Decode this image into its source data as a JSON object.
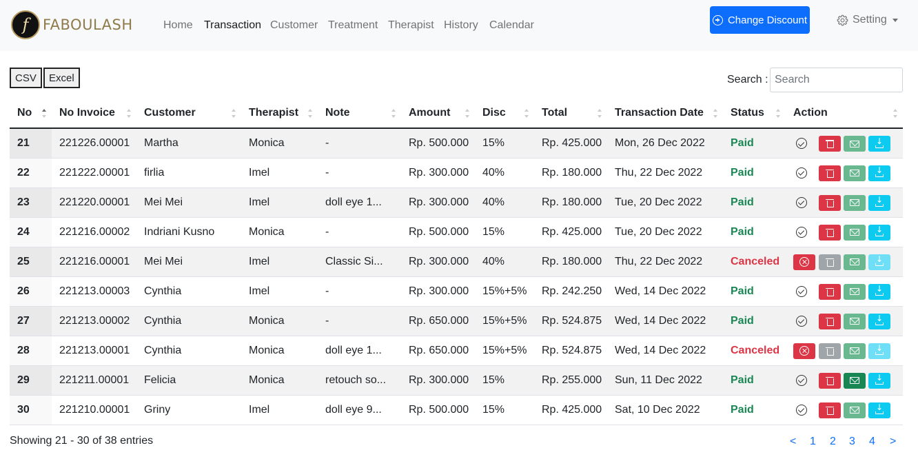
{
  "brand": {
    "name": "FABOULASH",
    "logo_glyph": "f"
  },
  "nav": [
    {
      "label": "Home",
      "active": false
    },
    {
      "label": "Transaction",
      "active": true
    },
    {
      "label": "Customer",
      "active": false
    },
    {
      "label": "Treatment",
      "active": false
    },
    {
      "label": "Therapist",
      "active": false
    },
    {
      "label": "History",
      "active": false
    },
    {
      "label": "Calendar",
      "active": false
    }
  ],
  "header": {
    "discount_button": "Change Discount",
    "setting_label": "Setting"
  },
  "toolbar": {
    "csv_label": "CSV",
    "excel_label": "Excel",
    "search_label": "Search :",
    "search_placeholder": "Search"
  },
  "table": {
    "columns": [
      "No",
      "No Invoice",
      "Customer",
      "Therapist",
      "Note",
      "Amount",
      "Disc",
      "Total",
      "Transaction Date",
      "Status",
      "Action"
    ],
    "rows": [
      {
        "no": "21",
        "invoice": "221226.00001",
        "customer": "Martha",
        "therapist": "Monica",
        "note": "-",
        "amount": "Rp. 500.000",
        "disc": "15%",
        "total": "Rp. 425.000",
        "date": "Mon, 26 Dec 2022",
        "status": "Paid"
      },
      {
        "no": "22",
        "invoice": "221222.00001",
        "customer": "firlia",
        "therapist": "Imel",
        "note": "-",
        "amount": "Rp. 300.000",
        "disc": "40%",
        "total": "Rp. 180.000",
        "date": "Thu, 22 Dec 2022",
        "status": "Paid"
      },
      {
        "no": "23",
        "invoice": "221220.00001",
        "customer": "Mei Mei",
        "therapist": "Imel",
        "note": "doll eye 1...",
        "amount": "Rp. 300.000",
        "disc": "40%",
        "total": "Rp. 180.000",
        "date": "Tue, 20 Dec 2022",
        "status": "Paid"
      },
      {
        "no": "24",
        "invoice": "221216.00002",
        "customer": "Indriani Kusno",
        "therapist": "Monica",
        "note": "-",
        "amount": "Rp. 500.000",
        "disc": "15%",
        "total": "Rp. 425.000",
        "date": "Tue, 20 Dec 2022",
        "status": "Paid"
      },
      {
        "no": "25",
        "invoice": "221216.00001",
        "customer": "Mei Mei",
        "therapist": "Imel",
        "note": "Classic Si...",
        "amount": "Rp. 300.000",
        "disc": "40%",
        "total": "Rp. 180.000",
        "date": "Thu, 22 Dec 2022",
        "status": "Canceled"
      },
      {
        "no": "26",
        "invoice": "221213.00003",
        "customer": "Cynthia",
        "therapist": "Imel",
        "note": "-",
        "amount": "Rp. 300.000",
        "disc": "15%+5%",
        "total": "Rp. 242.250",
        "date": "Wed, 14 Dec 2022",
        "status": "Paid"
      },
      {
        "no": "27",
        "invoice": "221213.00002",
        "customer": "Cynthia",
        "therapist": "Monica",
        "note": "-",
        "amount": "Rp. 650.000",
        "disc": "15%+5%",
        "total": "Rp. 524.875",
        "date": "Wed, 14 Dec 2022",
        "status": "Paid"
      },
      {
        "no": "28",
        "invoice": "221213.00001",
        "customer": "Cynthia",
        "therapist": "Monica",
        "note": "doll eye 1...",
        "amount": "Rp. 650.000",
        "disc": "15%+5%",
        "total": "Rp. 524.875",
        "date": "Wed, 14 Dec 2022",
        "status": "Canceled"
      },
      {
        "no": "29",
        "invoice": "221211.00001",
        "customer": "Felicia",
        "therapist": "Monica",
        "note": "retouch so...",
        "amount": "Rp. 300.000",
        "disc": "15%",
        "total": "Rp. 255.000",
        "date": "Sun, 11 Dec 2022",
        "status": "Paid",
        "mail_dark": true
      },
      {
        "no": "30",
        "invoice": "221210.00001",
        "customer": "Griny",
        "therapist": "Imel",
        "note": "doll eye 9...",
        "amount": "Rp. 500.000",
        "disc": "15%",
        "total": "Rp. 425.000",
        "date": "Sat, 10 Dec 2022",
        "status": "Paid"
      }
    ]
  },
  "footer": {
    "info": "Showing 21 - 30 of 38 entries",
    "pages": [
      "<",
      "1",
      "2",
      "3",
      "4",
      ">"
    ]
  },
  "colors": {
    "primary": "#0d6efd",
    "paid": "#198754",
    "canceled": "#dc3545",
    "info": "#0dcaf0",
    "nav_bg": "#f8f9fa"
  }
}
